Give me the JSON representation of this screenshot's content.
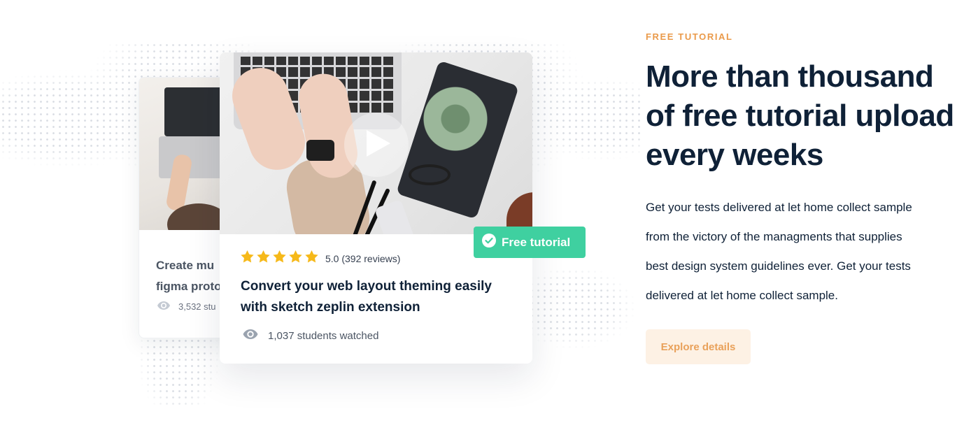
{
  "colors": {
    "accent_orange": "#ea9a4a",
    "badge_green": "#3fd0a0",
    "heading_navy": "#0f2137",
    "star_yellow": "#f6b91a",
    "button_bg": "#fdf1e4"
  },
  "back_card": {
    "title": "Create mu\nfigma proto",
    "students": "3,532 stu",
    "eye_icon": "eye-icon"
  },
  "front_card": {
    "play_icon": "play-icon",
    "badge": {
      "icon": "check-circle-icon",
      "label": "Free tutorial"
    },
    "rating": {
      "stars": 5,
      "score_text": "5.0 (392 reviews)"
    },
    "title": "Convert your web layout theming easily with sketch zeplin extension",
    "students": "1,037 students watched",
    "eye_icon": "eye-icon"
  },
  "section": {
    "eyebrow": "FREE TUTORIAL",
    "heading": "More than  thousand\nof free tutorial upload\nevery weeks",
    "description": "Get your tests delivered at let home collect sample\nfrom the victory of the managments that supplies\nbest design system guidelines ever. Get your tests\ndelivered at let home collect sample.",
    "cta_label": "Explore details"
  }
}
